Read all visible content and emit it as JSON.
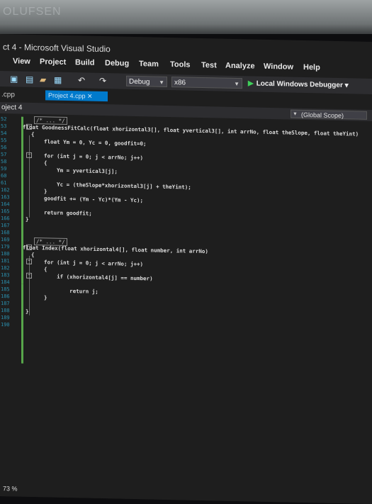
{
  "bezel": {
    "brand": "OLUFSEN"
  },
  "window": {
    "title": "ct 4 - Microsoft Visual Studio"
  },
  "menu": [
    "View",
    "Project",
    "Build",
    "Debug",
    "Team",
    "Tools",
    "Test",
    "Analyze",
    "Window",
    "Help"
  ],
  "toolbar": {
    "configuration": "Debug",
    "platform": "x86",
    "debugger": "Local Windows Debugger"
  },
  "tabs": {
    "file_tab": ".cpp",
    "project_tab": "Project 4.cpp"
  },
  "navbar": {
    "project": "oject 4",
    "scope": "(Global Scope)"
  },
  "editor": {
    "line_numbers": [
      "52",
      "53",
      "54",
      "55",
      "56",
      "57",
      "58",
      "59",
      "60",
      "61",
      "162",
      "163",
      "164",
      "165",
      "166",
      "167",
      "168",
      "169",
      "179",
      "180",
      "181",
      "182",
      "183",
      "184",
      "185",
      "186",
      "187",
      "188",
      "189",
      "190"
    ],
    "fold1": "/* ... */",
    "func1": [
      "float GoodnessFitCalc(float xhorizontal3[], float yvertical3[], int arrNo, float theSlope, float theYint)",
      "{",
      "    float Ym = 0, Yc = 0, goodfit=0;",
      "",
      "    for (int j = 0; j < arrNo; j++)",
      "    {",
      "        Ym = yvertical3[j];",
      "",
      "        Yc = (theSlope*xhorizontal3[j] + theYint);",
      "    }",
      "    goodfit += (Ym - Yc)*(Ym - Yc);",
      "",
      "    return goodfit;",
      "}"
    ],
    "fold2": "/* ... */",
    "func2": [
      "float Index(float xhorizontal4[], float number, int arrNo)",
      "{",
      "    for (int j = 0; j < arrNo; j++)",
      "    {",
      "        if (xhorizontal4[j] == number)",
      "",
      "            return j;",
      "    }",
      "}"
    ]
  },
  "status": {
    "zoom": "73 %"
  }
}
